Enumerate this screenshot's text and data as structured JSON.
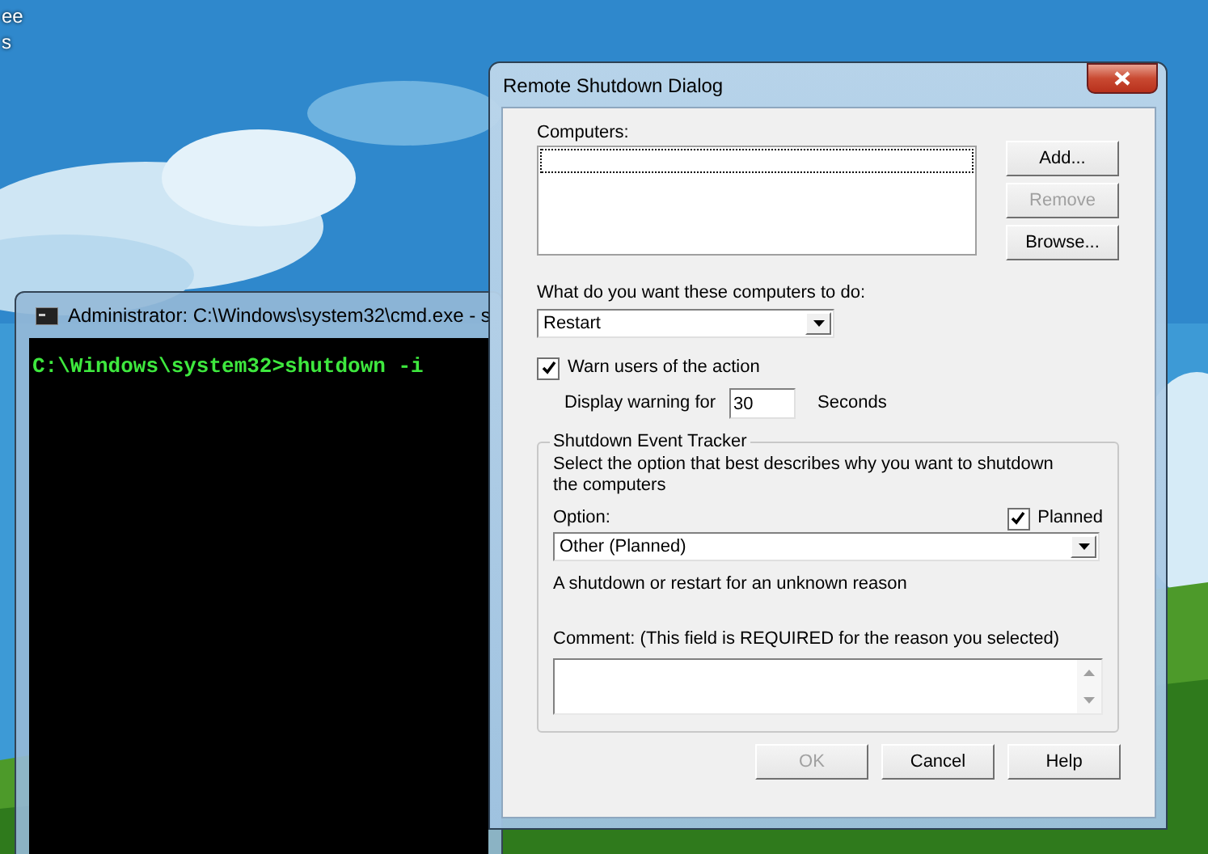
{
  "desktop": {
    "icon_labels": [
      "ee",
      "s"
    ]
  },
  "console": {
    "title": "Administrator: C:\\Windows\\system32\\cmd.exe - s",
    "lines": [
      "C:\\Windows\\system32>shutdown -i"
    ]
  },
  "dialog": {
    "title": "Remote Shutdown Dialog",
    "computers_label": "Computers:",
    "side_buttons": [
      {
        "label": "Add...",
        "disabled": false
      },
      {
        "label": "Remove",
        "disabled": true
      },
      {
        "label": "Browse...",
        "disabled": false
      }
    ],
    "action_label": "What do you want these computers to do:",
    "action_select": {
      "value": "Restart"
    },
    "warn": {
      "label": "Warn users of the action",
      "checked": true
    },
    "warning": {
      "label": "Display warning for",
      "value": "30",
      "unit": "Seconds"
    },
    "tracker": {
      "title": "Shutdown Event Tracker",
      "description": "Select the option that best describes why you want to shutdown the computers",
      "option_label": "Option:",
      "planned": {
        "label": "Planned",
        "checked": true
      },
      "option_select": {
        "value": "Other (Planned)"
      },
      "reason": "A shutdown or restart for an unknown reason",
      "comment_label": "Comment: (This field is REQUIRED for the reason you selected)"
    },
    "buttons": [
      {
        "label": "OK",
        "disabled": true
      },
      {
        "label": "Cancel",
        "disabled": false
      },
      {
        "label": "Help",
        "disabled": false
      }
    ]
  }
}
